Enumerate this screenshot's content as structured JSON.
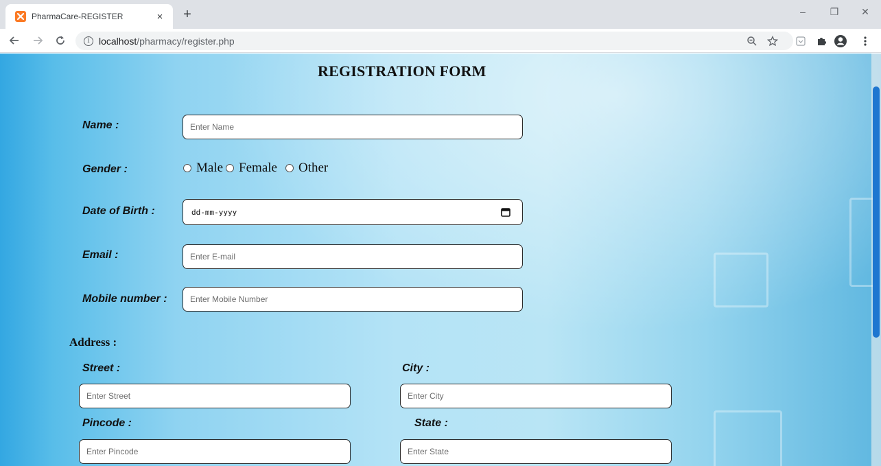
{
  "browser": {
    "tab_title": "PharmaCare-REGISTER",
    "tab_close": "×",
    "new_tab": "+",
    "url_host": "localhost",
    "url_path": "/pharmacy/register.php",
    "window_controls": {
      "minimize": "–",
      "restore": "❐",
      "close": "✕"
    }
  },
  "form": {
    "title": "REGISTRATION FORM",
    "name": {
      "label": "Name :",
      "placeholder": "Enter Name"
    },
    "gender": {
      "label": "Gender :",
      "options": [
        "Male",
        "Female",
        "Other"
      ]
    },
    "dob": {
      "label": "Date of Birth :",
      "placeholder": "dd-mm-yyyy"
    },
    "email": {
      "label": "Email :",
      "placeholder": "Enter E-mail"
    },
    "mobile": {
      "label": "Mobile number :",
      "placeholder": "Enter Mobile Number"
    },
    "address": {
      "label": "Address :",
      "street": {
        "label": "Street :",
        "placeholder": "Enter Street"
      },
      "city": {
        "label": "City :",
        "placeholder": "Enter City"
      },
      "pincode": {
        "label": "Pincode :",
        "placeholder": "Enter Pincode"
      },
      "state": {
        "label": "State :",
        "placeholder": "Enter State"
      }
    }
  },
  "colors": {
    "scroll_thumb": "#1e76d0",
    "favicon": "#fb7a24",
    "page_bg_light": "#b9e5f5",
    "page_bg_dark": "#33a7e2"
  }
}
